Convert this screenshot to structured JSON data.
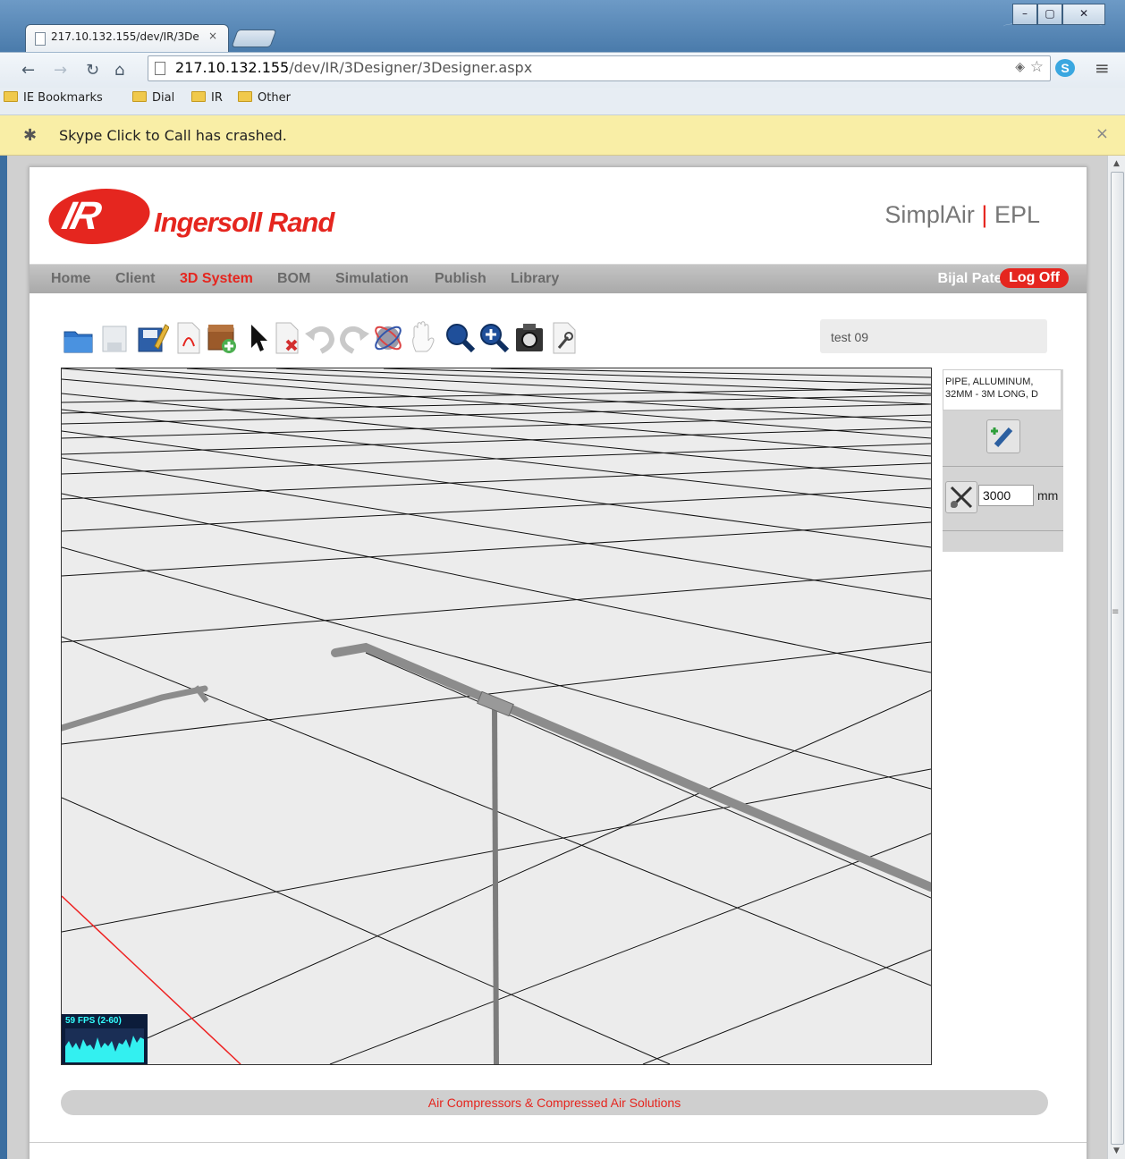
{
  "browser": {
    "tab_title": "217.10.132.155/dev/IR/3De",
    "tab_close": "×",
    "url_host": "217.10.132.155",
    "url_path": "/dev/IR/3Designer/3Designer.aspx",
    "bookmarks": [
      "IE Bookmarks",
      "Dial",
      "IR",
      "Other"
    ],
    "infobar_message": "Skype Click to Call has crashed."
  },
  "header": {
    "logo_badge": "IR",
    "logo_name": "Ingersoll Rand",
    "brand_left": "SimplAir",
    "brand_sep": "|",
    "brand_right": "EPL"
  },
  "nav": {
    "items": [
      "Home",
      "Client",
      "3D System",
      "BOM",
      "Simulation",
      "Publish",
      "Library"
    ],
    "active": "3D System",
    "user": "Bijal Patel",
    "logoff": "Log Off"
  },
  "toolbar_icons": [
    "open-folder-icon",
    "save-icon",
    "save-as-icon",
    "pdf-icon",
    "add-component-icon",
    "select-arrow-icon",
    "delete-icon",
    "undo-icon",
    "redo-icon",
    "rotate-icon",
    "pan-hand-icon",
    "zoom-icon",
    "zoom-in-icon",
    "snapshot-icon",
    "properties-icon"
  ],
  "project": {
    "name": "test 09"
  },
  "viewer": {
    "fps_label": "59 FPS (2-60)"
  },
  "component_panel": {
    "description": "PIPE, ALLUMINUM, 32MM - 3M LONG, D",
    "length_value": "3000",
    "length_unit": "mm"
  },
  "footer": {
    "text": "Air Compressors & Compressed Air Solutions"
  },
  "colors": {
    "brand_red": "#e5261f",
    "nav_grey": "#b5b5b5"
  }
}
